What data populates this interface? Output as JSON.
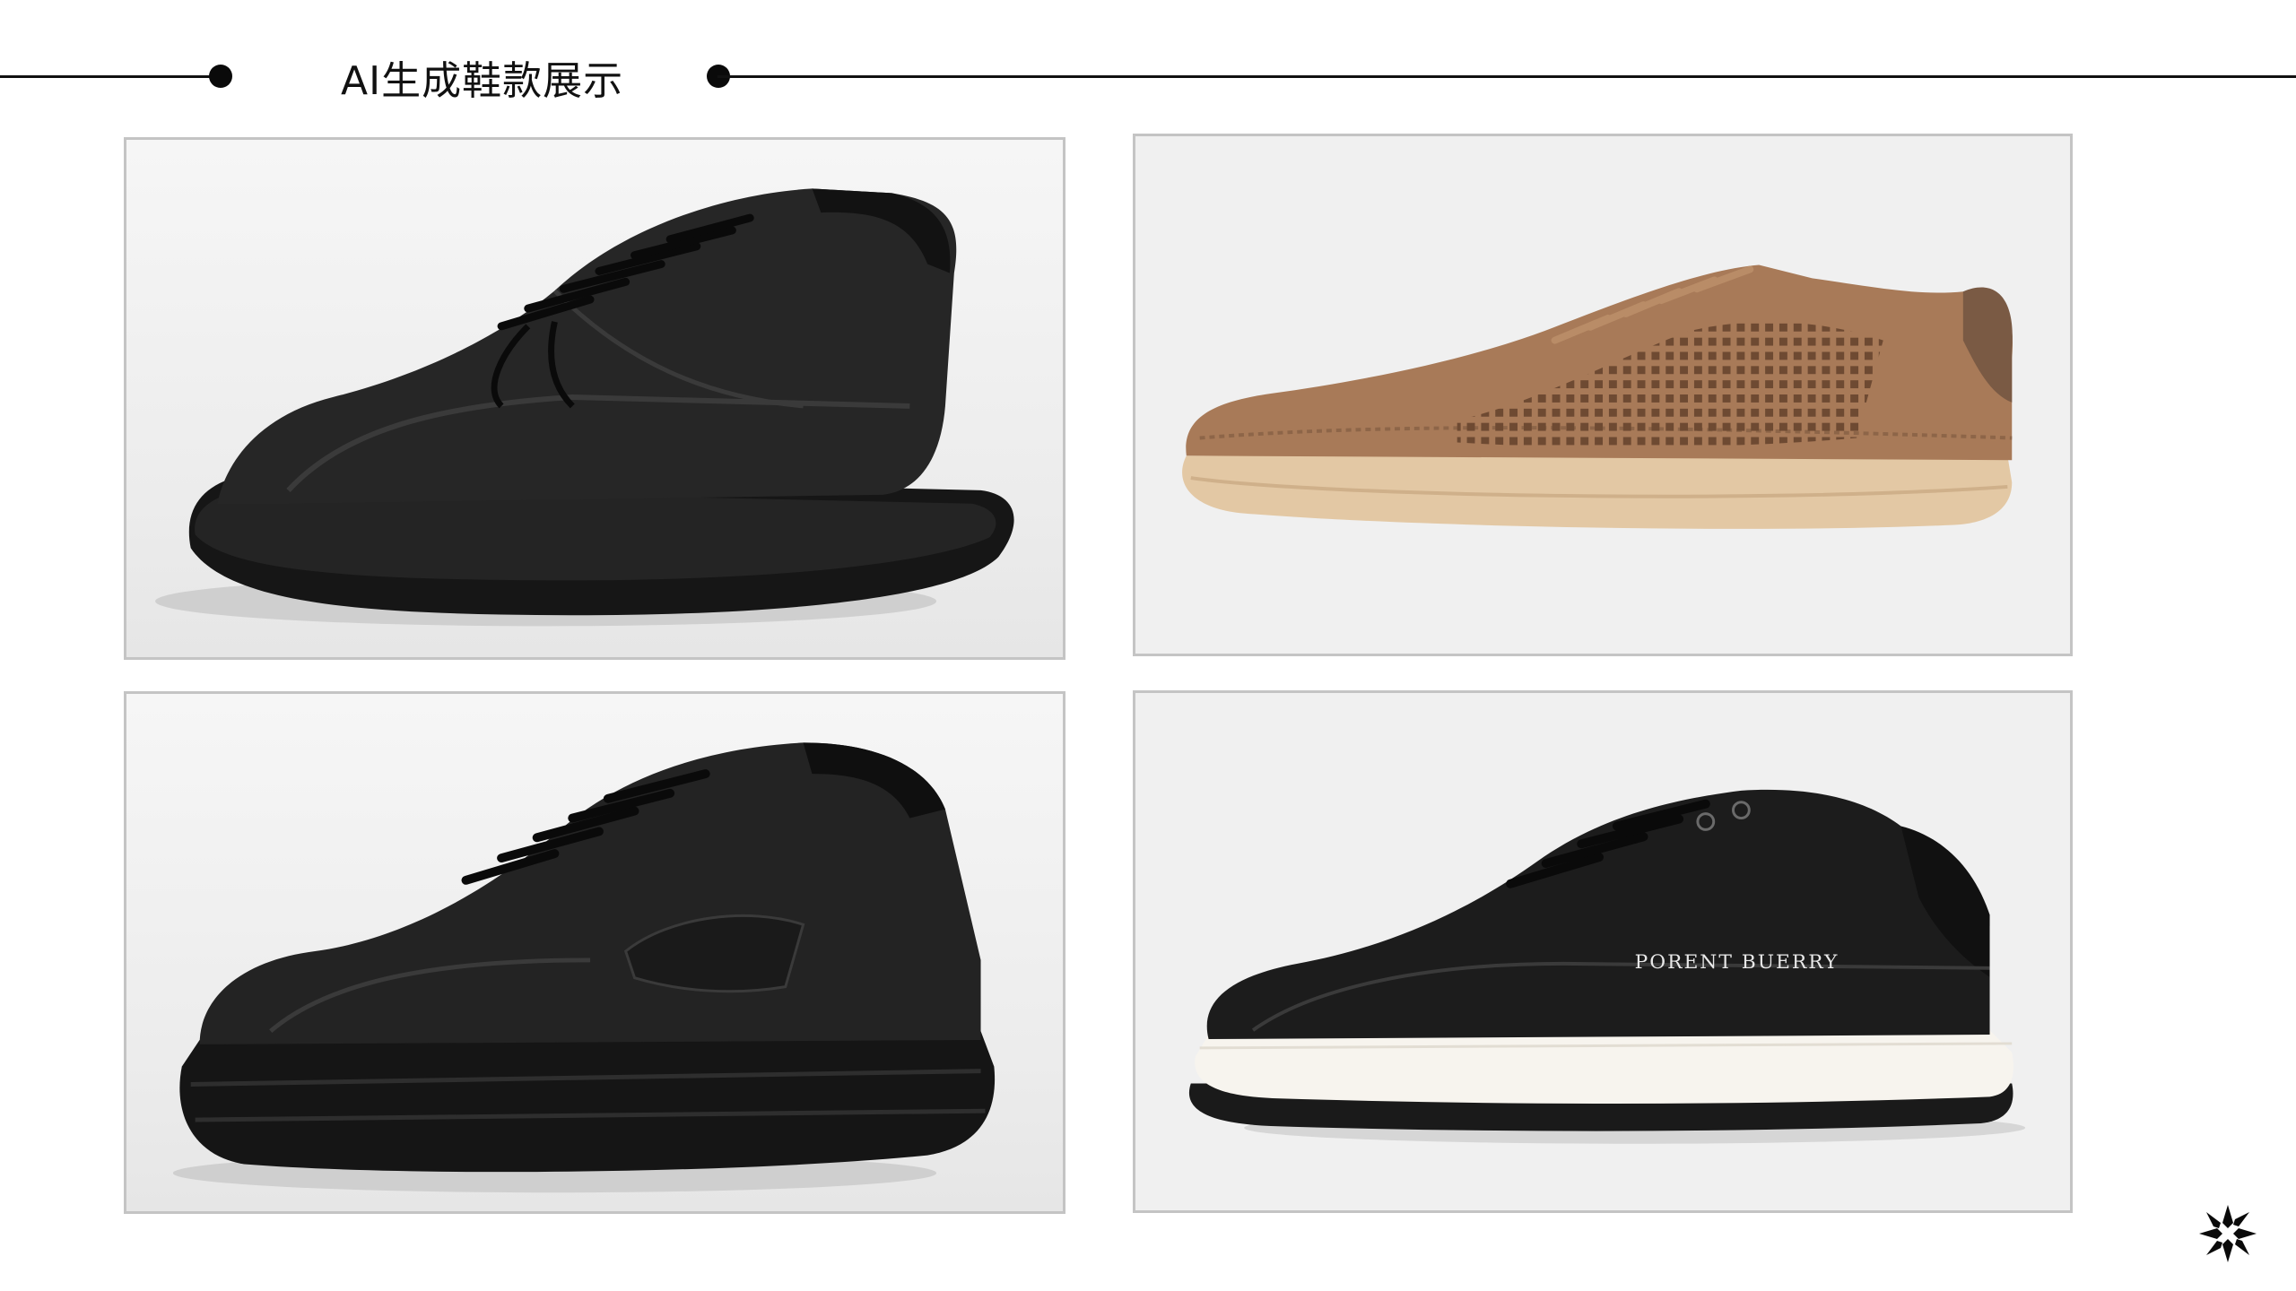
{
  "header": {
    "title": "AI生成鞋款展示"
  },
  "gallery": [
    {
      "id": "shoe-1",
      "description": "black leather chunky sneaker"
    },
    {
      "id": "shoe-2",
      "description": "tan perforated suede sneaker"
    },
    {
      "id": "shoe-3",
      "description": "black leather platform sneaker with woven panel"
    },
    {
      "id": "shoe-4",
      "description": "black and white leather court sneaker",
      "brand_text": "PORENT BUERRY"
    }
  ],
  "colors": {
    "accent": "#111111",
    "frame_border": "#c4c4c4",
    "frame_bg": "#f0f0f0",
    "tan_suede": "#a87a58",
    "gum_sole": "#e3c8a4"
  },
  "icons": {
    "corner_logo": "sparkle-burst-icon"
  }
}
